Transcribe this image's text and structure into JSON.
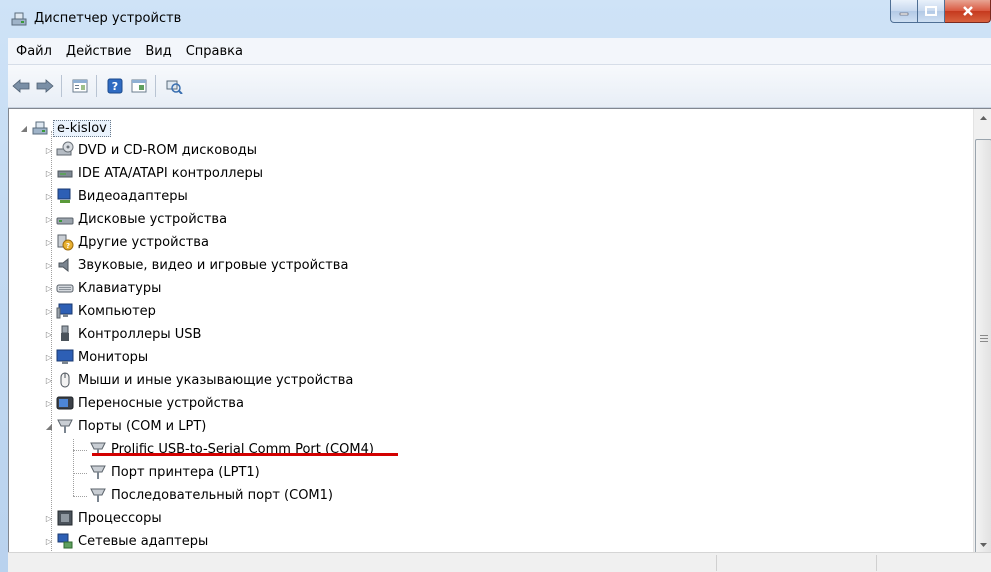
{
  "window": {
    "title": "Диспетчер устройств"
  },
  "menu": [
    "Файл",
    "Действие",
    "Вид",
    "Справка"
  ],
  "toolbar": {
    "buttons": [
      "back-icon",
      "forward-icon",
      "properties-icon",
      "help-icon",
      "driver-icon",
      "scan-hardware-icon"
    ]
  },
  "tree": {
    "root": "e-kislov",
    "categories": [
      {
        "label": "DVD и CD-ROM дисководы",
        "icon": "dvd-drive-icon"
      },
      {
        "label": "IDE ATA/ATAPI контроллеры",
        "icon": "ide-controller-icon"
      },
      {
        "label": "Видеоадаптеры",
        "icon": "display-adapter-icon"
      },
      {
        "label": "Дисковые устройства",
        "icon": "disk-drive-icon"
      },
      {
        "label": "Другие устройства",
        "icon": "unknown-device-icon"
      },
      {
        "label": "Звуковые, видео и игровые устройства",
        "icon": "speaker-icon"
      },
      {
        "label": "Клавиатуры",
        "icon": "keyboard-icon"
      },
      {
        "label": "Компьютер",
        "icon": "computer-icon"
      },
      {
        "label": "Контроллеры USB",
        "icon": "usb-icon"
      },
      {
        "label": "Мониторы",
        "icon": "monitor-icon"
      },
      {
        "label": "Мыши и иные указывающие устройства",
        "icon": "mouse-icon"
      },
      {
        "label": "Переносные устройства",
        "icon": "portable-device-icon"
      },
      {
        "label": "Порты (COM и LPT)",
        "icon": "port-icon"
      },
      {
        "label": "Процессоры",
        "icon": "processor-icon"
      },
      {
        "label": "Сетевые адаптеры",
        "icon": "network-adapter-icon"
      }
    ],
    "ports_children": [
      {
        "label": "Prolific USB-to-Serial Comm Port (COM4)",
        "highlight": "#d30000"
      },
      {
        "label": "Порт принтера (LPT1)"
      },
      {
        "label": "Последовательный порт (COM1)"
      }
    ]
  },
  "colors": {
    "title_gradient": "#c3daf2",
    "close_button": "#c5391e",
    "underline": "#d30000"
  }
}
